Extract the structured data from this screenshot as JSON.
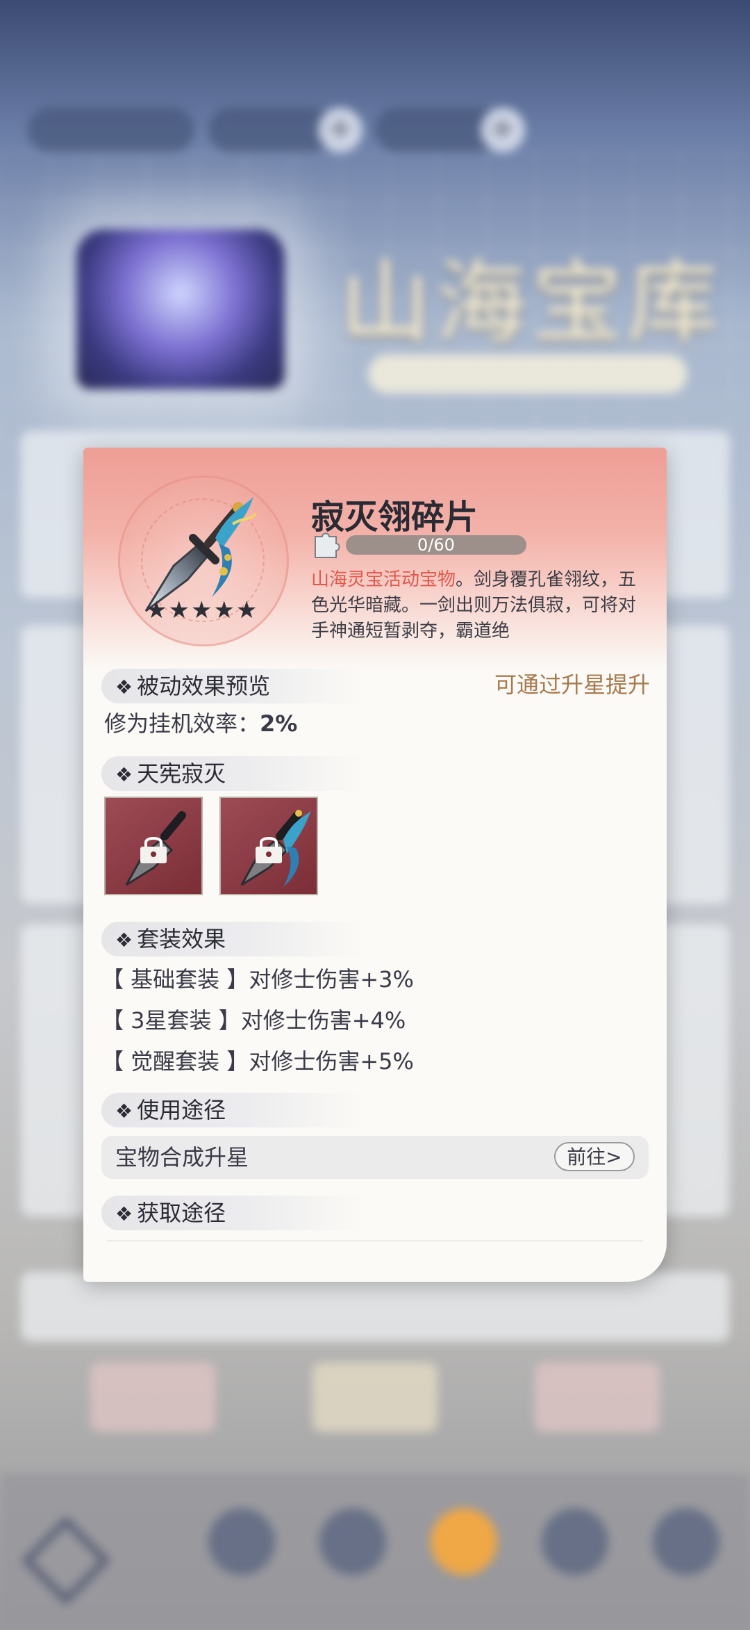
{
  "background": {
    "title": "山海宝库"
  },
  "item": {
    "name": "寂灭翎碎片",
    "stars": 5,
    "fragments": {
      "current": 0,
      "max": 60,
      "text": "0/60"
    },
    "desc_highlight": "山海灵宝活动宝物",
    "desc_rest": "。剑身覆孔雀翎纹，五色光华暗藏。一剑出则万法俱寂，可将对手神通短暂剥夺，霸道绝"
  },
  "passive": {
    "label": "被动效果预览",
    "hint": "可通过升星提升",
    "stat_label": "修为挂机效率：",
    "stat_value": "2%"
  },
  "skill": {
    "label": "天宪寂灭"
  },
  "set_effect": {
    "label": "套装效果",
    "lines": [
      {
        "tag": "【 基础套装 】",
        "text": "对修士伤害+3%"
      },
      {
        "tag": "【 3星套装 】",
        "text": "对修士伤害+4%"
      },
      {
        "tag": "【 觉醒套装 】",
        "text": "对修士伤害+5%"
      }
    ]
  },
  "usage": {
    "label": "使用途径",
    "row_label": "宝物合成升星",
    "button": "前往>"
  },
  "obtain": {
    "label": "获取途径"
  },
  "colors": {
    "accent": "#e0584c",
    "hint": "#a8794c",
    "skill_bg": "#7b2e37"
  }
}
